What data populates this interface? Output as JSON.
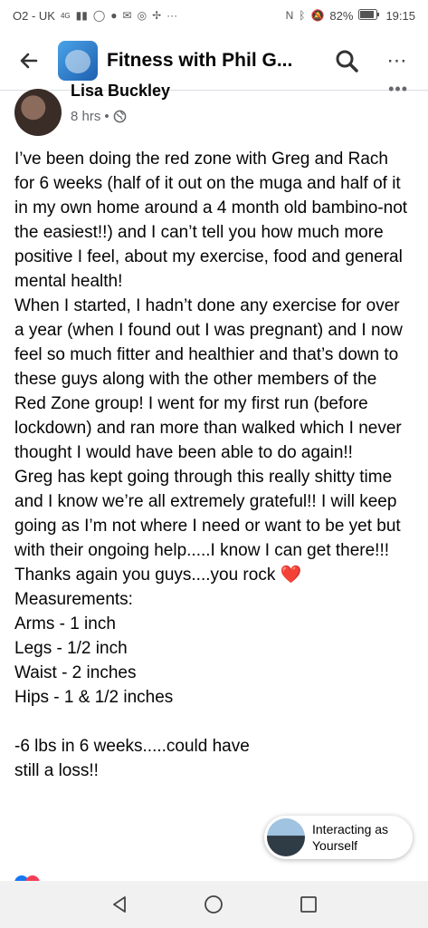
{
  "status_bar": {
    "carrier": "O2 - UK",
    "network": "4G",
    "battery": "82%",
    "time": "19:15"
  },
  "header": {
    "title": "Fitness with Phil G...",
    "more_icon": "⋯"
  },
  "post": {
    "author": "Lisa Buckley",
    "time": "8 hrs",
    "separator": "•",
    "paragraphs": [
      "I’ve been doing the red zone with Greg and Rach for 6 weeks (half of it out on the muga and half of it in my own home around a 4 month old bambino-not the easiest!!) and I can’t tell you how much more positive I feel, about my exercise, food and general mental health!",
      "When I started, I hadn’t done any exercise for over a year (when I found out I was pregnant) and I now feel so much fitter and healthier and that’s down to these guys along with the other members of the Red Zone group! I went for my first run (before lockdown) and ran more than walked which I never thought I would have been able to do again!!",
      "Greg has kept going through this really shitty time and I know we’re all extremely grateful!! I will keep going as I’m not where I need or want to be yet but with their ongoing help.....I know I can get there!!!",
      "Thanks again you guys....you rock",
      "Measurements:",
      "Arms - 1 inch",
      "Legs - 1/2 inch",
      "Waist - 2 inches",
      "Hips - 1 & 1/2 inches",
      "-6 lbs in 6 weeks.....could have",
      "still a loss!!"
    ],
    "heart": "❤️"
  },
  "interacting": {
    "line1": "Interacting as",
    "line2": "Yourself"
  },
  "colors": {
    "heart": "#e0242a",
    "meta": "#65676b"
  }
}
